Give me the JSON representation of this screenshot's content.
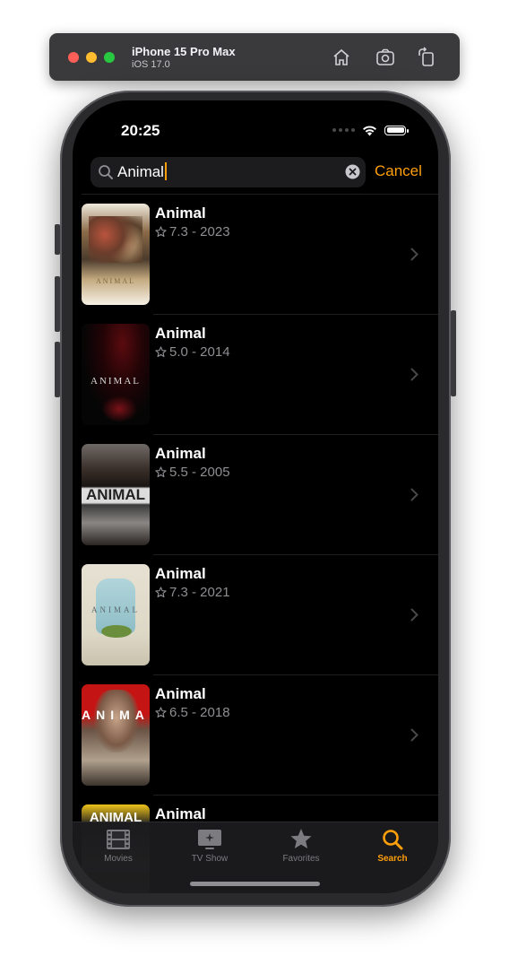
{
  "simulator": {
    "device_name": "iPhone 15 Pro Max",
    "os_version": "iOS 17.0",
    "icons": [
      "home-icon",
      "screenshot-icon",
      "rotate-icon"
    ]
  },
  "status_bar": {
    "time": "20:25"
  },
  "search": {
    "query": "Animal",
    "cancel_label": "Cancel",
    "accent_color": "#ff9f0a"
  },
  "results": [
    {
      "title": "Animal",
      "meta": "7.3 - 2023",
      "poster_text": "ANIMAL"
    },
    {
      "title": "Animal",
      "meta": "5.0 - 2014",
      "poster_text": "ANIMAL"
    },
    {
      "title": "Animal",
      "meta": "5.5 - 2005",
      "poster_text": "ANIMAL"
    },
    {
      "title": "Animal",
      "meta": "7.3 - 2021",
      "poster_text": "ANIMAL"
    },
    {
      "title": "Animal",
      "meta": "6.5 - 2018",
      "poster_text": "ANIMAL"
    },
    {
      "title": "Animal",
      "meta": "",
      "poster_text": "ANIMAL"
    }
  ],
  "tab_bar": {
    "tabs": [
      {
        "label": "Movies",
        "icon": "film-icon",
        "active": false
      },
      {
        "label": "TV Show",
        "icon": "tv-icon",
        "active": false
      },
      {
        "label": "Favorites",
        "icon": "star-icon",
        "active": false
      },
      {
        "label": "Search",
        "icon": "search-icon",
        "active": true
      }
    ]
  }
}
